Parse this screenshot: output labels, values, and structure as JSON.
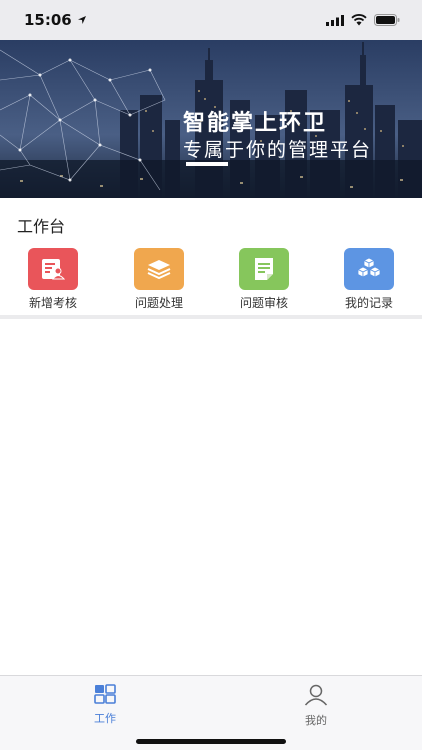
{
  "status_bar": {
    "time": "15:06"
  },
  "banner": {
    "title": "智能掌上环卫",
    "subtitle": "专属于你的管理平台"
  },
  "workbench": {
    "title": "工作台",
    "tiles": [
      {
        "label": "新增考核",
        "icon": "add-assessment-icon",
        "color": "#e9555a"
      },
      {
        "label": "问题处理",
        "icon": "layers-icon",
        "color": "#f0a74e"
      },
      {
        "label": "问题审核",
        "icon": "document-icon",
        "color": "#86c65c"
      },
      {
        "label": "我的记录",
        "icon": "cubes-icon",
        "color": "#5d95e3"
      }
    ]
  },
  "tabbar": {
    "tabs": [
      {
        "label": "工作",
        "icon": "grid-icon",
        "active": true
      },
      {
        "label": "我的",
        "icon": "user-icon",
        "active": false
      }
    ],
    "active_color": "#4a7fd8",
    "inactive_color": "#666666"
  }
}
